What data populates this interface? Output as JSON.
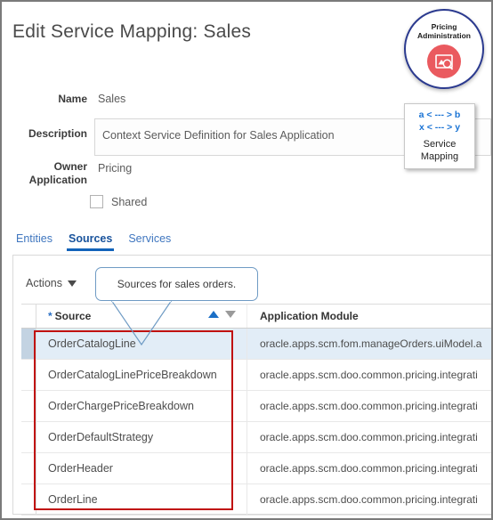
{
  "page": {
    "title": "Edit Service Mapping: Sales"
  },
  "badge": {
    "line1": "Pricing",
    "line2": "Administration",
    "icon": "pricing-tag-icon",
    "border_color": "#2b3a8f",
    "icon_bg_color": "#ea5a5f"
  },
  "legend": {
    "mapping_line_1": "a < --- > b",
    "mapping_line_2": "x < --- > y",
    "label_line_1": "Service",
    "label_line_2": "Mapping",
    "accent_color": "#1a73d4"
  },
  "form": {
    "name": {
      "label": "Name",
      "value": "Sales"
    },
    "description": {
      "label": "Description",
      "value": "Context Service Definition for Sales Application",
      "placeholder": ""
    },
    "owner_application": {
      "label": "Owner\nApplication",
      "label_line1": "Owner",
      "label_line2": "Application",
      "value": "Pricing"
    },
    "shared": {
      "label": "Shared",
      "checked": false
    }
  },
  "tabs": [
    {
      "label": "Entities",
      "active": false
    },
    {
      "label": "Sources",
      "active": true
    },
    {
      "label": "Services",
      "active": false
    }
  ],
  "toolbar": {
    "actions_label": "Actions",
    "actions_icon": "chevron-down-icon"
  },
  "callout": {
    "text": "Sources for sales orders.",
    "border_color": "#6f9bc4"
  },
  "highlight": {
    "color": "#c0110f"
  },
  "table": {
    "columns": [
      {
        "label": "Source",
        "required": true,
        "sort_asc_icon": "sort-ascending-icon",
        "sort_desc_icon": "sort-descending-icon"
      },
      {
        "label": "Application Module",
        "required": false
      }
    ],
    "rows": [
      {
        "source": "OrderCatalogLine",
        "module": "oracle.apps.scm.fom.manageOrders.uiModel.a",
        "selected": true
      },
      {
        "source": "OrderCatalogLinePriceBreakdown",
        "module": "oracle.apps.scm.doo.common.pricing.integrati",
        "selected": false
      },
      {
        "source": "OrderChargePriceBreakdown",
        "module": "oracle.apps.scm.doo.common.pricing.integrati",
        "selected": false
      },
      {
        "source": "OrderDefaultStrategy",
        "module": "oracle.apps.scm.doo.common.pricing.integrati",
        "selected": false
      },
      {
        "source": "OrderHeader",
        "module": "oracle.apps.scm.doo.common.pricing.integrati",
        "selected": false
      },
      {
        "source": "OrderLine",
        "module": "oracle.apps.scm.doo.common.pricing.integrati",
        "selected": false
      }
    ]
  }
}
